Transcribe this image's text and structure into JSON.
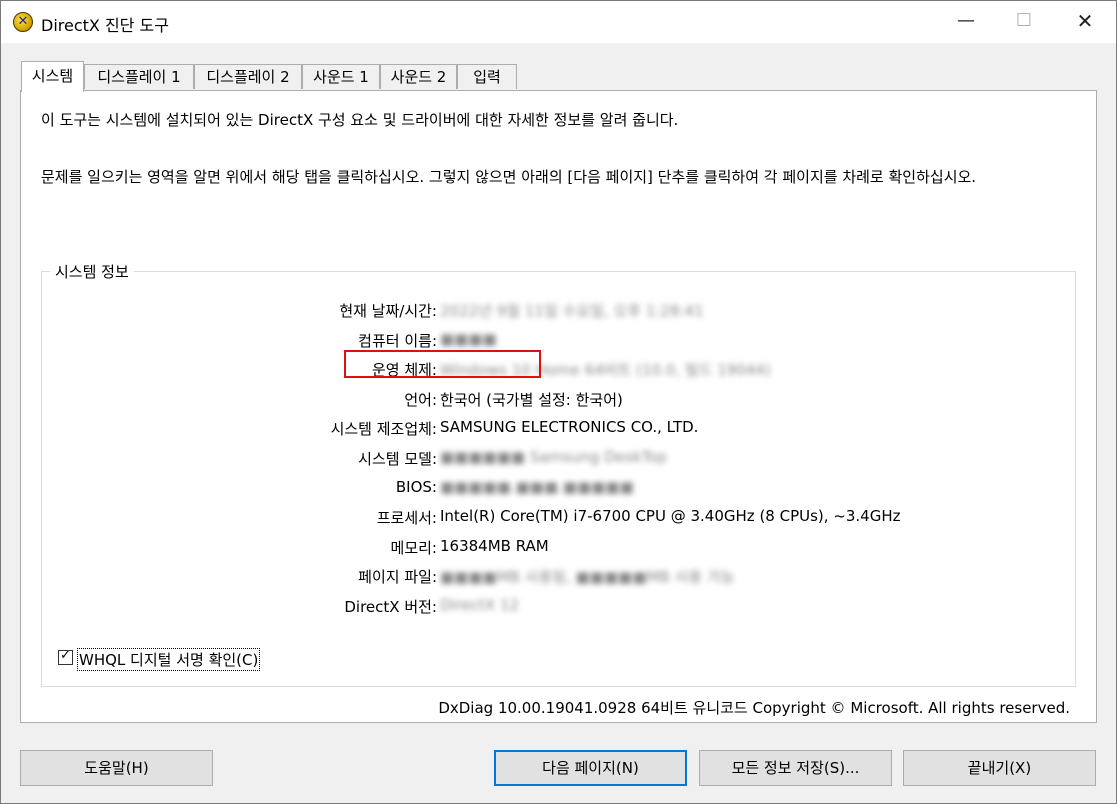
{
  "window": {
    "title": "DirectX 진단 도구",
    "icon": "directx-icon"
  },
  "window_controls": {
    "minimize": "—",
    "maximize": "☐",
    "close": "✕"
  },
  "tabs": [
    {
      "label": "시스템",
      "active": true
    },
    {
      "label": "디스플레이 1",
      "active": false
    },
    {
      "label": "디스플레이 2",
      "active": false
    },
    {
      "label": "사운드 1",
      "active": false
    },
    {
      "label": "사운드 2",
      "active": false
    },
    {
      "label": "입력",
      "active": false
    }
  ],
  "intro": {
    "line1": "이 도구는 시스템에 설치되어 있는 DirectX 구성 요소 및 드라이버에 대한 자세한 정보를 알려 줍니다.",
    "line2": "문제를 일으키는 영역을 알면 위에서 해당 탭을 클릭하십시오. 그렇지 않으면 아래의 [다음 페이지] 단추를 클릭하여 각 페이지를 차례로 확인하십시오."
  },
  "system_info": {
    "legend": "시스템 정보",
    "rows": [
      {
        "label": "현재 날짜/시간:",
        "value": "2022년 9월 11일 수요일, 오후 1:28:41",
        "blurred": true
      },
      {
        "label": "컴퓨터 이름:",
        "value": "■■■■",
        "blurred": true
      },
      {
        "label": "운영 체제:",
        "value": "Windows 10 Home 64비트 (10.0, 빌드 19044)",
        "blurred": true
      },
      {
        "label": "언어:",
        "value": "한국어 (국가별 설정: 한국어)",
        "blurred": false
      },
      {
        "label": "시스템 제조업체:",
        "value": "SAMSUNG ELECTRONICS CO., LTD.",
        "blurred": false
      },
      {
        "label": "시스템 모델:",
        "value": "■■■■■■ Samsung DeskTop",
        "blurred": true
      },
      {
        "label": "BIOS:",
        "value": "■■■■■.■■■.■■■■■",
        "blurred": true
      },
      {
        "label": "프로세서:",
        "value": "Intel(R) Core(TM) i7-6700 CPU @ 3.40GHz (8 CPUs), ~3.4GHz",
        "blurred": false
      },
      {
        "label": "메모리:",
        "value": "16384MB RAM",
        "blurred": false,
        "highlighted": true
      },
      {
        "label": "페이지 파일:",
        "value": "■■■■MB 사용됨, ■■■■■MB 사용 가능",
        "blurred": true
      },
      {
        "label": "DirectX 버전:",
        "value": "DirectX 12",
        "blurred": true
      }
    ],
    "whql": {
      "label": "WHQL 디지털 서명 확인(C)",
      "checked": true
    }
  },
  "footer": {
    "copyright": "DxDiag 10.00.19041.0928 64비트 유니코드  Copyright © Microsoft. All rights reserved."
  },
  "buttons": {
    "help": "도움말(H)",
    "next_page": "다음 페이지(N)",
    "save_all": "모든 정보 저장(S)...",
    "exit": "끝내기(X)"
  },
  "colors": {
    "highlight_border": "#e01010",
    "default_button_border": "#0078d7"
  }
}
